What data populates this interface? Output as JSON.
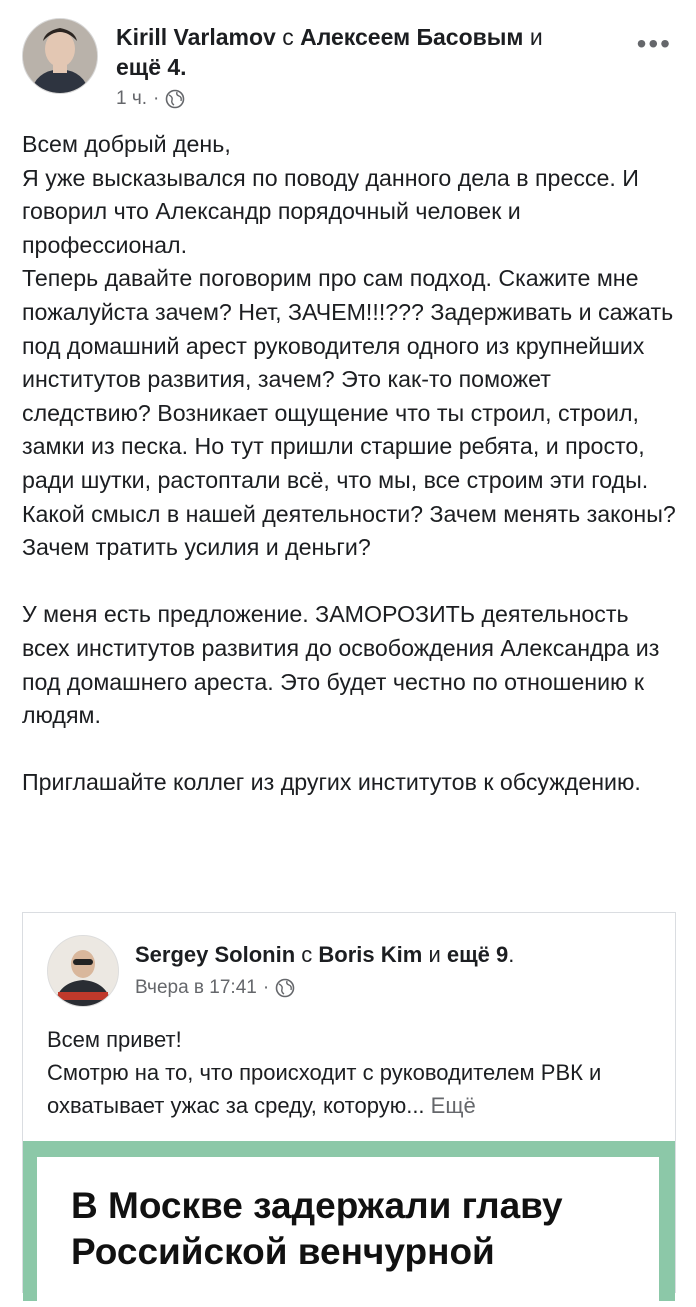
{
  "post": {
    "author": "Kirill Varlamov",
    "with_word": "с",
    "tagged": "Алексеем Басовым",
    "and_word": "и",
    "others": "ещё 4.",
    "time": "1 ч.",
    "separator": "·",
    "paragraphs": [
      [
        "Всем добрый день,",
        "Я уже высказывался по поводу данного дела в прессе. И говорил что Александр порядочный человек и профессионал.",
        "Теперь давайте поговорим про сам подход. Скажите мне пожалуйста зачем? Нет, ЗАЧЕМ!!!??? Задерживать и сажать под домашний арест руководителя одного из крупнейших институтов развития, зачем? Это как-то поможет следствию? Возникает ощущение что ты строил, строил, замки из песка. Но тут пришли старшие ребята, и просто, ради шутки, растоптали всё, что мы, все строим эти годы. Какой смысл в нашей деятельности? Зачем менять законы? Зачем тратить усилия и деньги?"
      ],
      [
        "У меня есть предложение. ЗАМОРОЗИТЬ деятельность всех институтов развития до освобождения Александра из под домашнего ареста. Это будет честно по отношению к людям."
      ],
      [
        "Приглашайте коллег из других институтов к обсуждению."
      ]
    ]
  },
  "shared": {
    "author": "Sergey Solonin",
    "with_word": "с",
    "tagged": "Boris Kim",
    "and_word": "и",
    "others": "ещё 9",
    "dot": ".",
    "time": "Вчера в 17:41",
    "separator": "·",
    "line1": "Всем привет!",
    "line2": "Смотрю на то, что происходит с руководителем РВК и охватывает ужас за среду, которую...",
    "see_more": "Ещё",
    "article_title": "В Москве задержали главу Российской венчурной"
  },
  "icons": {
    "more": "more-dots-icon",
    "audience": "globe-icon"
  },
  "colors": {
    "text": "#1c1e21",
    "secondary": "#65676b",
    "article_border": "#8cc8a8"
  }
}
